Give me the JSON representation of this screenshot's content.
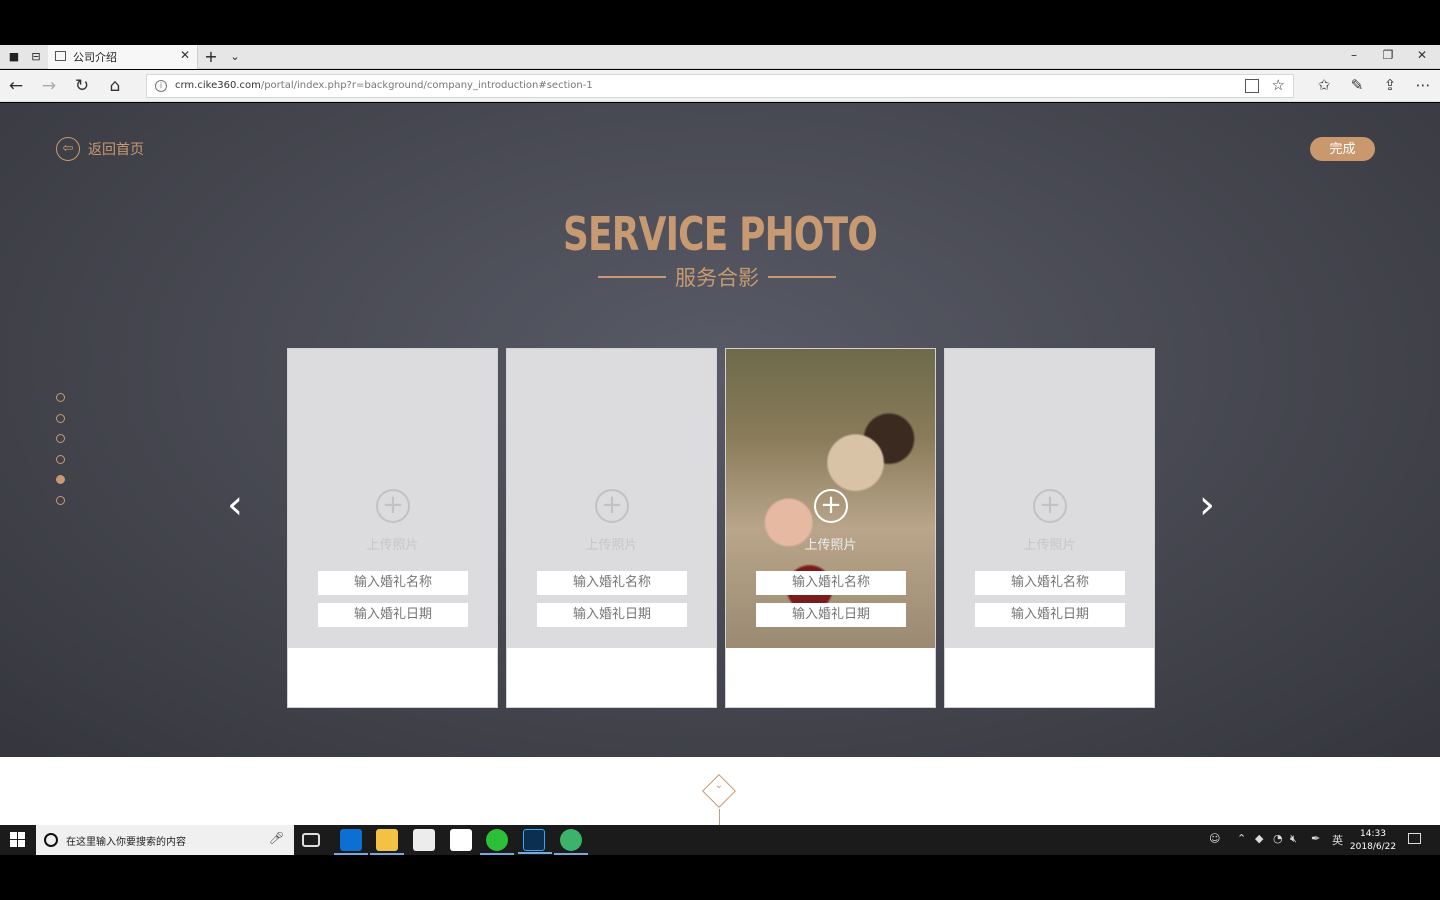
{
  "browser": {
    "tab_title": "公司介绍",
    "url_host": "crm.cike360.com",
    "url_path": "/portal/index.php?r=background/company_introduction#section-1"
  },
  "page": {
    "back_label": "返回首页",
    "done_label": "完成",
    "title": "SERVICE PHOTO",
    "subtitle": "服务合影",
    "accent_color": "#c89a72",
    "active_section_index": 4,
    "section_dots": 6
  },
  "cards": [
    {
      "upload_label": "上传照片",
      "name_placeholder": "输入婚礼名称",
      "date_placeholder": "输入婚礼日期",
      "has_photo": false
    },
    {
      "upload_label": "上传照片",
      "name_placeholder": "输入婚礼名称",
      "date_placeholder": "输入婚礼日期",
      "has_photo": false
    },
    {
      "upload_label": "上传照片",
      "name_placeholder": "输入婚礼名称",
      "date_placeholder": "输入婚礼日期",
      "has_photo": true
    },
    {
      "upload_label": "上传照片",
      "name_placeholder": "输入婚礼名称",
      "date_placeholder": "输入婚礼日期",
      "has_photo": false
    }
  ],
  "taskbar": {
    "search_placeholder": "在这里输入你要搜索的内容",
    "ime": "英",
    "time": "14:33",
    "date": "2018/6/22"
  }
}
